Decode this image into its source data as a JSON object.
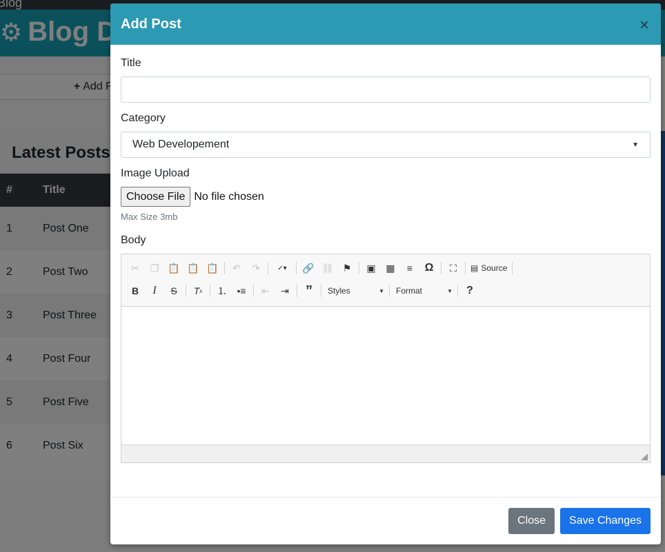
{
  "background": {
    "nav_brand": "Blog",
    "header_title": "Blog D",
    "add_post_label": "Add Post",
    "posts_header": "Latest Posts",
    "table": {
      "columns": [
        "#",
        "Title"
      ],
      "rows": [
        {
          "num": "1",
          "title": "Post One"
        },
        {
          "num": "2",
          "title": "Post Two"
        },
        {
          "num": "3",
          "title": "Post Three"
        },
        {
          "num": "4",
          "title": "Post Four"
        },
        {
          "num": "5",
          "title": "Post Five"
        },
        {
          "num": "6",
          "title": "Post Six"
        }
      ]
    }
  },
  "modal": {
    "title": "Add Post",
    "close_symbol": "×",
    "title_field": {
      "label": "Title",
      "value": ""
    },
    "category": {
      "label": "Category",
      "selected": "Web Developement"
    },
    "image_upload": {
      "label": "Image Upload",
      "button": "Choose File",
      "status": "No file chosen",
      "help": "Max Size 3mb"
    },
    "body": {
      "label": "Body",
      "source_label": "Source",
      "styles_label": "Styles",
      "format_label": "Format"
    },
    "footer": {
      "close_label": "Close",
      "save_label": "Save Changes"
    }
  },
  "colors": {
    "header": "#2b9ab2",
    "save": "#1a73e8",
    "close": "#6c757d"
  }
}
